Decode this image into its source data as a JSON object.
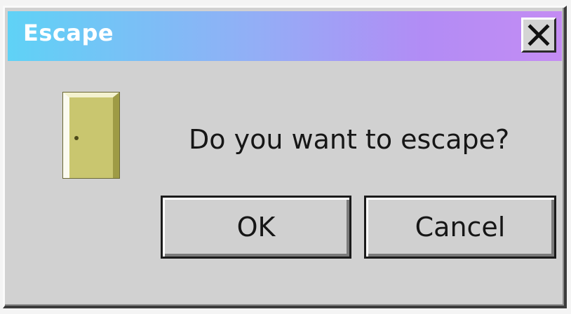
{
  "window": {
    "title": "Escape",
    "close_glyph": "X",
    "icon": "door-icon"
  },
  "dialog": {
    "message": "Do you want to escape?"
  },
  "buttons": {
    "ok_label": "OK",
    "cancel_label": "Cancel"
  },
  "colors": {
    "titlebar_gradient": [
      "#5fd2f6",
      "#93aef6",
      "#b28cf5",
      "#c48cf3"
    ],
    "title_text": "#ffffff",
    "dialog_bg": "#d1d1d1",
    "door_fill": "#c9c66f"
  }
}
